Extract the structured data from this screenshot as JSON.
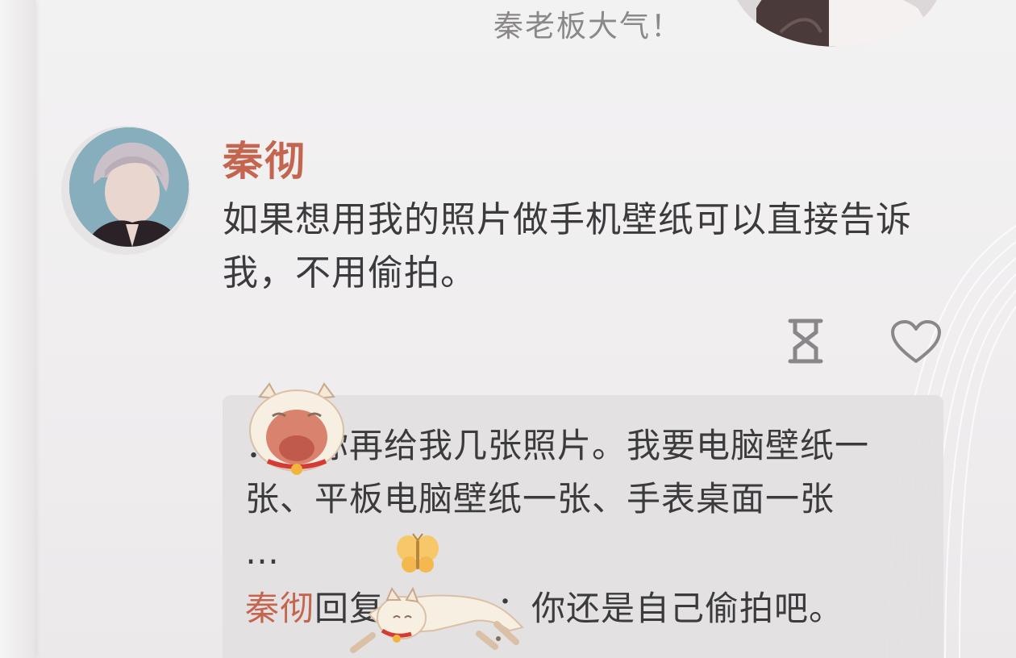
{
  "previous_comment": {
    "text": "秦老板大气！"
  },
  "comment": {
    "author": "秦彻",
    "text": "如果想用我的照片做手机壁纸可以直接告诉我，不用偷拍。"
  },
  "actions": {
    "hourglass_icon": "hourglass-icon",
    "like_icon": "heart-outline-icon"
  },
  "replies": [
    {
      "author": "",
      "separator": "：",
      "text": "那你再给我几张照片。我要电脑壁纸一张、平板电脑壁纸一张、手表桌面一张",
      "suffix": "…"
    },
    {
      "author": "秦彻",
      "reply_word": "回复",
      "target": "",
      "separator": "：",
      "text": "你还是自己偷拍吧。"
    }
  ],
  "colors": {
    "accent": "#c4664f",
    "text": "#3b3a3c",
    "muted": "#8b8888",
    "reply_bg": "#e2dfe1"
  }
}
